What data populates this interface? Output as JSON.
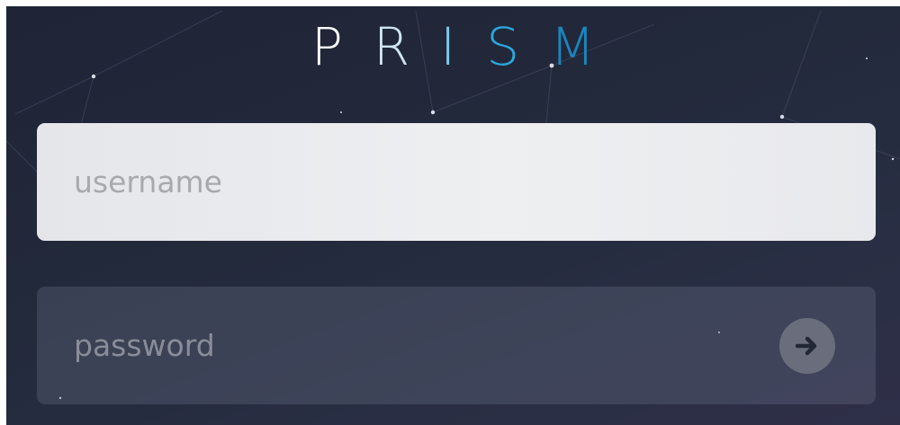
{
  "logo": {
    "letters": [
      {
        "char": "P",
        "color": "#ffffff"
      },
      {
        "char": "R",
        "color": "#cfe5f0"
      },
      {
        "char": "I",
        "color": "#7fc9ea"
      },
      {
        "char": "S",
        "color": "#2aa9e0"
      },
      {
        "char": "M",
        "color": "#1b86bd"
      }
    ]
  },
  "login": {
    "username_placeholder": "username",
    "password_placeholder": "password",
    "submit_icon": "arrow-right-icon"
  },
  "colors": {
    "background": "#232a3c",
    "field_light": "#eceef0",
    "field_dark": "#3c4254",
    "button": "#6a6e7c",
    "button_arrow": "#232838"
  }
}
